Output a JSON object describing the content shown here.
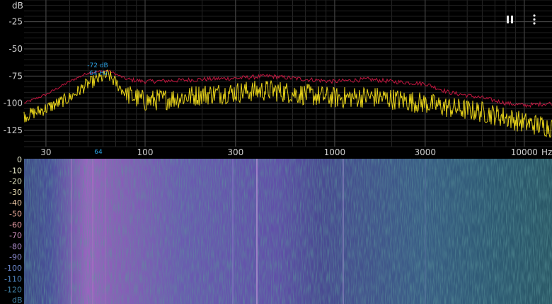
{
  "spectrum": {
    "y_unit": "dB",
    "y_ticks": [
      "-25",
      "-50",
      "-75",
      "-100",
      "-125"
    ],
    "x_unit": "Hz",
    "x_ticks": [
      "30",
      "100",
      "300",
      "1000",
      "3000",
      "10000"
    ],
    "x_tick_values": [
      30,
      100,
      300,
      1000,
      3000,
      10000
    ],
    "y_tick_values": [
      -25,
      -50,
      -75,
      -100,
      -125
    ],
    "peak_marker": {
      "level_text": "-72 dB",
      "freq_text": "64 Hz",
      "axis_text": "64",
      "freq": 64,
      "level": -72
    },
    "colors": {
      "grid": "#3a3a3a",
      "peak_line": "#c0163f",
      "live_line": "#e6d21a",
      "marker": "#2a9fe0",
      "axis_text": "#cfcfcf"
    }
  },
  "spectrogram": {
    "y_unit": "dB",
    "y_ticks": [
      "0",
      "-10",
      "-20",
      "-30",
      "-40",
      "-50",
      "-60",
      "-70",
      "-80",
      "-90",
      "-100",
      "-110",
      "-120"
    ],
    "tick_colors": [
      "#e9ecd0",
      "#e3e7c5",
      "#dfe2bd",
      "#e1d6ad",
      "#e6c2a0",
      "#eaa898",
      "#e59aa3",
      "#c98bb8",
      "#a989c7",
      "#8d8cd2",
      "#6f8bd3",
      "#4f86c2",
      "#3f7fa3"
    ]
  },
  "toolbar": {
    "pause_icon": "pause-icon",
    "menu_icon": "more-vert-icon"
  },
  "chart_data": {
    "type": "line",
    "xlabel": "Hz",
    "ylabel": "dB",
    "xscale": "log",
    "xlim": [
      23,
      14000
    ],
    "ylim": [
      -140,
      -5
    ],
    "series": [
      {
        "x": [
          23,
          30,
          40,
          50,
          64,
          80,
          100,
          150,
          200,
          300,
          450,
          700,
          1000,
          1500,
          2000,
          3000,
          4000,
          6000,
          8000,
          10000,
          14000
        ],
        "y": [
          -100,
          -92,
          -80,
          -72,
          -70,
          -78,
          -80,
          -79,
          -78,
          -77,
          -75,
          -78,
          -80,
          -78,
          -80,
          -82,
          -90,
          -95,
          -100,
          -102,
          -100
        ]
      },
      {
        "x": [
          23,
          30,
          40,
          50,
          64,
          80,
          100,
          150,
          200,
          300,
          450,
          700,
          1000,
          1500,
          2000,
          3000,
          4000,
          6000,
          8000,
          10000,
          14000
        ],
        "y": [
          -112,
          -105,
          -95,
          -82,
          -74,
          -92,
          -98,
          -95,
          -92,
          -90,
          -88,
          -92,
          -95,
          -94,
          -96,
          -100,
          -104,
          -108,
          -113,
          -118,
          -122
        ]
      }
    ]
  }
}
